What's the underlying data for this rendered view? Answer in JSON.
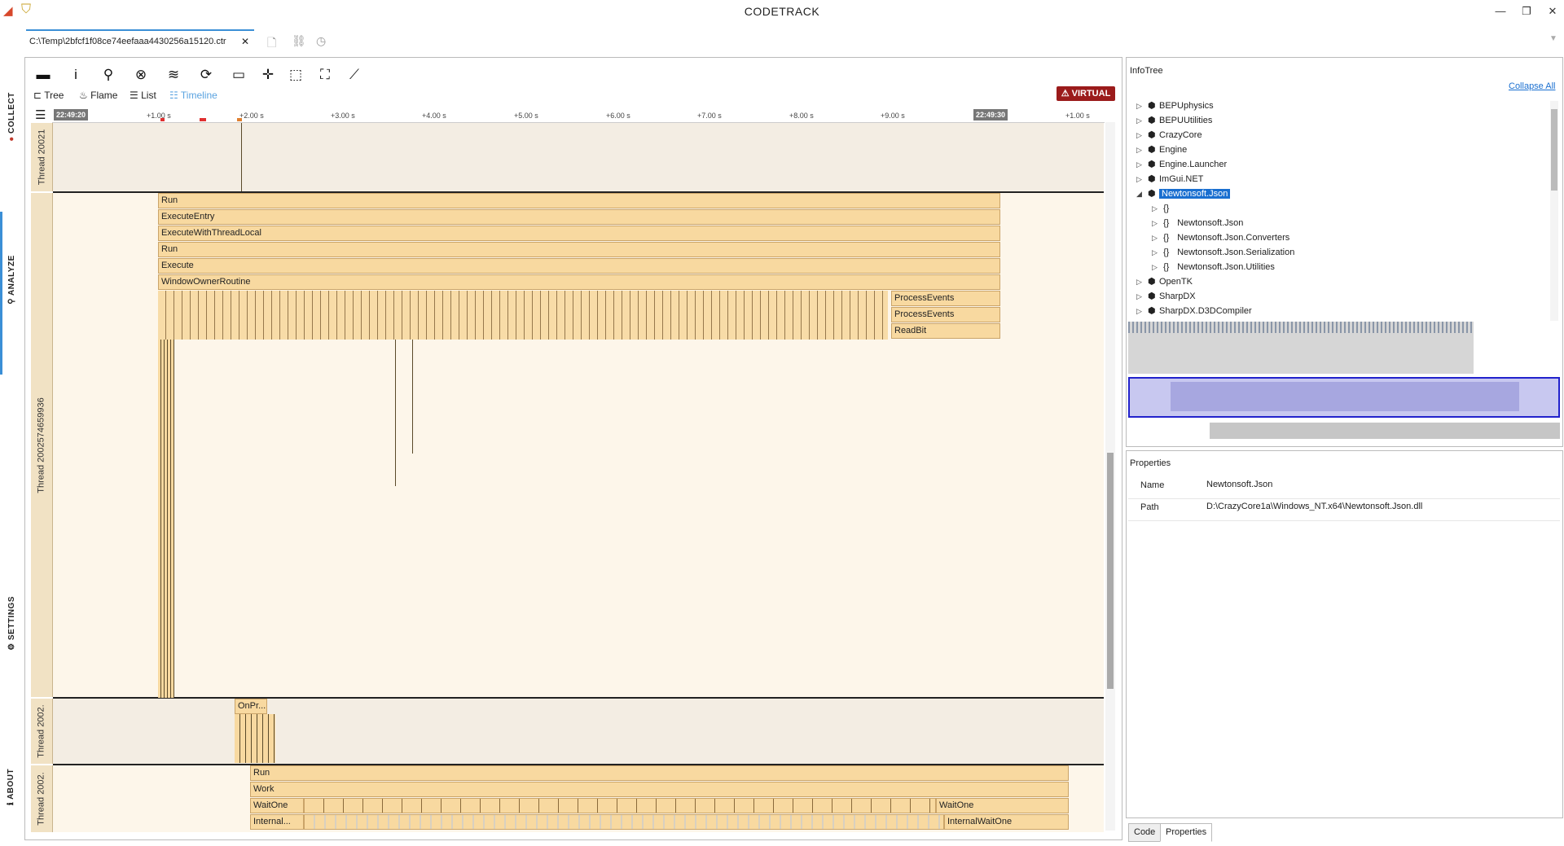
{
  "app": {
    "title": "CODETRACK"
  },
  "rail": {
    "collect": "COLLECT",
    "analyze": "ANALYZE",
    "settings": "SETTINGS",
    "about": "ABOUT"
  },
  "doc_tab": {
    "label": "C:\\Temp\\2bfcf1f08ce74eefaaa4430256a15120.ctr",
    "close": "✕"
  },
  "views": {
    "tree": "Tree",
    "flame": "Flame",
    "list": "List",
    "timeline": "Timeline"
  },
  "badge": "VIRTUAL",
  "ruler": {
    "start": "22:49:20",
    "end": "22:49:30",
    "ticks": [
      "+1.00 s",
      "+2.00 s",
      "+3.00 s",
      "+4.00 s",
      "+5.00 s",
      "+6.00 s",
      "+7.00 s",
      "+8.00 s",
      "+9.00 s",
      "+1.00 s"
    ]
  },
  "threads": [
    {
      "label": "Thread 20021"
    },
    {
      "label": "Thread 2002574659936"
    },
    {
      "label": "Thread 2002."
    },
    {
      "label": "Thread 2002."
    }
  ],
  "frames_main": [
    "Run",
    "ExecuteEntry",
    "ExecuteWithThreadLocal",
    "Run",
    "Execute",
    "WindowOwnerRoutine"
  ],
  "frames_right": [
    "ProcessEvents",
    "ProcessEvents",
    "ReadBit"
  ],
  "frame_onpr": "OnPr...",
  "frames_t4": [
    "Run",
    "Work",
    "WaitOne",
    "Internal..."
  ],
  "frames_t4_right": [
    "WaitOne",
    "InternalWaitOne"
  ],
  "infotree": {
    "title": "InfoTree",
    "collapse_all": "Collapse All",
    "items": [
      {
        "label": "BEPUphysics",
        "level": 0,
        "expanded": false
      },
      {
        "label": "BEPUUtilities",
        "level": 0,
        "expanded": false
      },
      {
        "label": "CrazyCore",
        "level": 0,
        "expanded": false
      },
      {
        "label": "Engine",
        "level": 0,
        "expanded": false
      },
      {
        "label": "Engine.Launcher",
        "level": 0,
        "expanded": false
      },
      {
        "label": "ImGui.NET",
        "level": 0,
        "expanded": false
      },
      {
        "label": "Newtonsoft.Json",
        "level": 0,
        "expanded": true,
        "selected": true
      },
      {
        "label": "",
        "level": 1,
        "expanded": false
      },
      {
        "label": "Newtonsoft.Json",
        "level": 1,
        "expanded": false
      },
      {
        "label": "Newtonsoft.Json.Converters",
        "level": 1,
        "expanded": false
      },
      {
        "label": "Newtonsoft.Json.Serialization",
        "level": 1,
        "expanded": false
      },
      {
        "label": "Newtonsoft.Json.Utilities",
        "level": 1,
        "expanded": false
      },
      {
        "label": "OpenTK",
        "level": 0,
        "expanded": false
      },
      {
        "label": "SharpDX",
        "level": 0,
        "expanded": false
      },
      {
        "label": "SharpDX.D3DCompiler",
        "level": 0,
        "expanded": false
      }
    ]
  },
  "properties": {
    "title": "Properties",
    "rows": [
      {
        "key": "Name",
        "value": "Newtonsoft.Json"
      },
      {
        "key": "Path",
        "value": "D:\\CrazyCore1a\\Windows_NT.x64\\Newtonsoft.Json.dll"
      }
    ]
  },
  "bottom_tabs": {
    "code": "Code",
    "properties": "Properties"
  },
  "colors": {
    "accent": "#3b8fd6",
    "frame": "#f8d9a0",
    "badge": "#9b1b1b",
    "selected": "#1a6fd0"
  }
}
